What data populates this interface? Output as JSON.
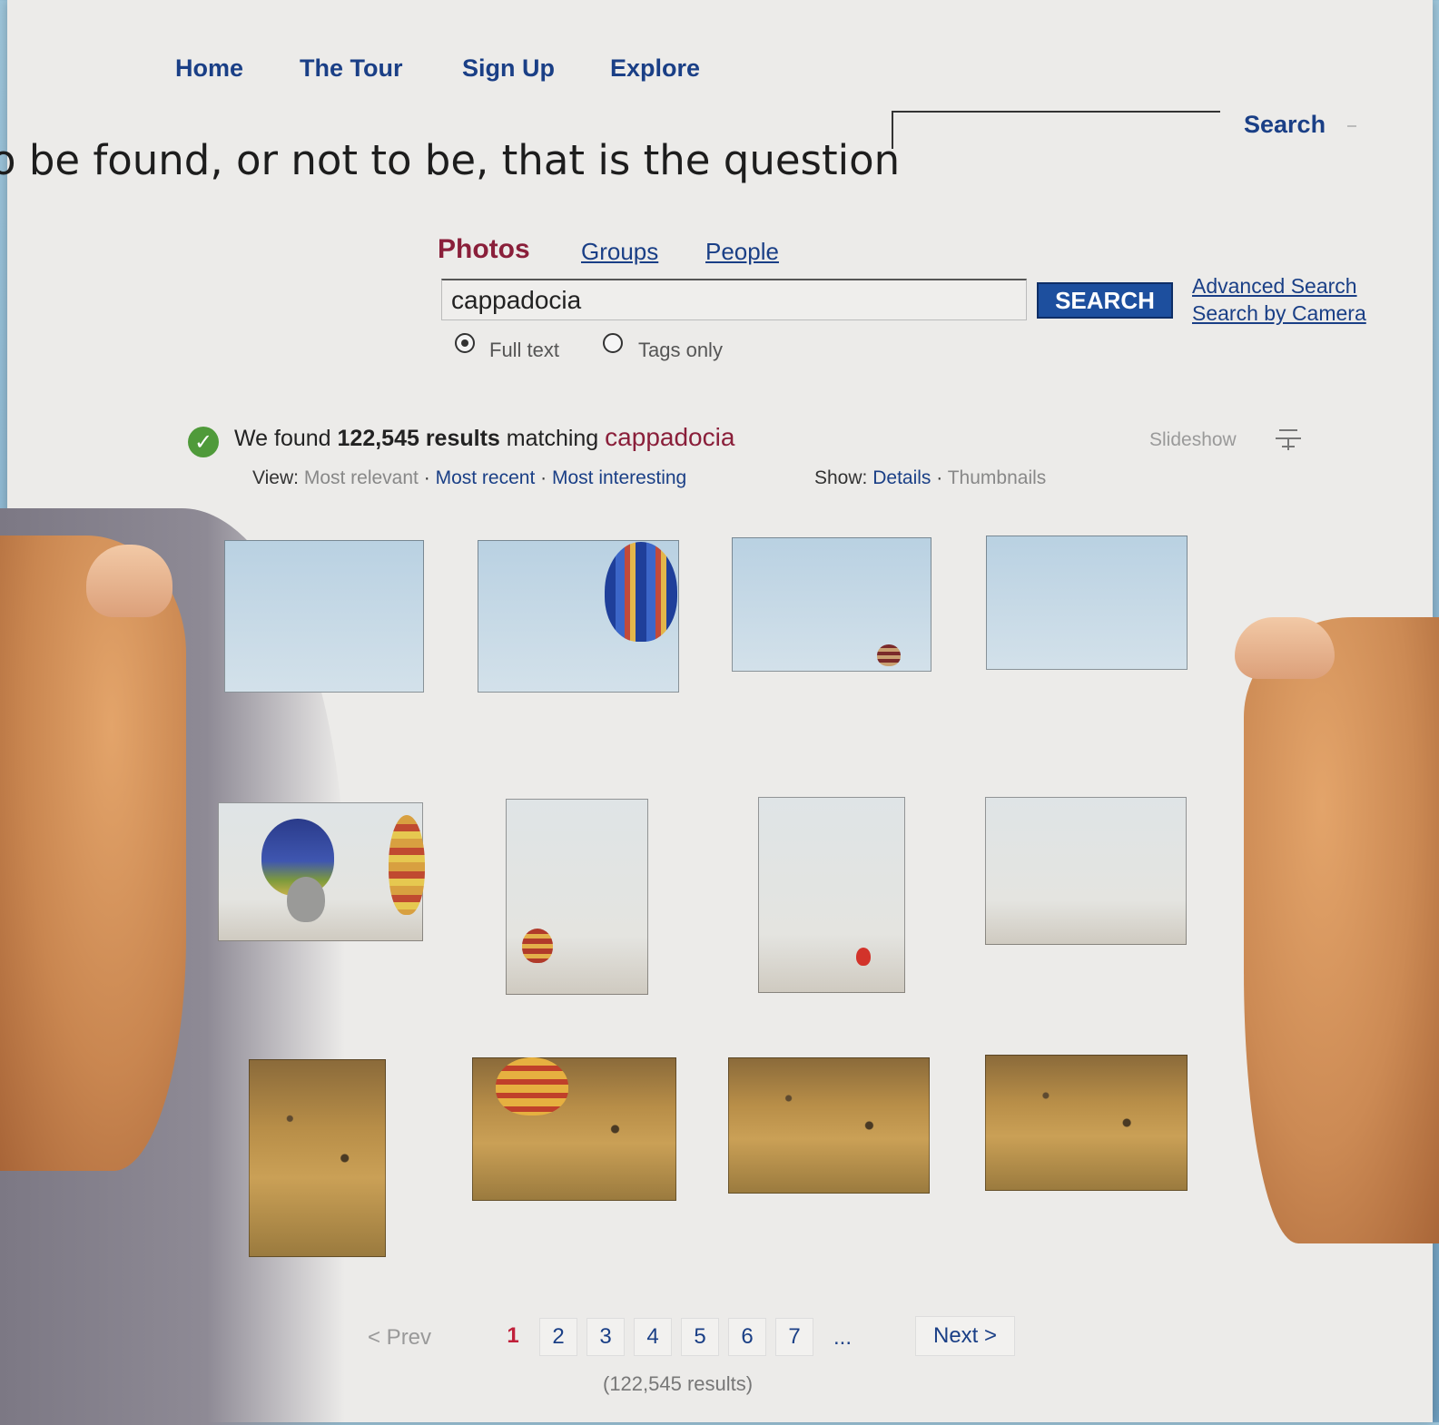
{
  "nav": {
    "home": "Home",
    "tour": "The Tour",
    "signup": "Sign Up",
    "explore": "Explore"
  },
  "top_search": {
    "label": "Search"
  },
  "tagline": "o be found, or not to be, that is the question",
  "tabs": {
    "photos": "Photos",
    "groups": "Groups",
    "people": "People"
  },
  "search": {
    "value": "cappadocia",
    "button": "SEARCH",
    "advanced": "Advanced Search",
    "camera": "Search by Camera"
  },
  "options": {
    "full_text": "Full text",
    "tags_only": "Tags only"
  },
  "results": {
    "prefix": "We found",
    "count": "122,545 results",
    "matching": "matching",
    "query": "cappadocia",
    "view_label": "View:",
    "view_relevant": "Most relevant",
    "view_recent": "Most recent",
    "view_interesting": "Most interesting",
    "show_label": "Show:",
    "show_details": "Details",
    "show_thumbnails": "Thumbnails",
    "slideshow": "Slideshow",
    "sep": "·"
  },
  "pager": {
    "prev": "< Prev",
    "pages": [
      "1",
      "2",
      "3",
      "4",
      "5",
      "6",
      "7"
    ],
    "ellipsis": "...",
    "next": "Next >",
    "total": "(122,545 results)"
  },
  "colors": {
    "link": "#1a3f86",
    "accent": "#8a1f3a",
    "button": "#1d4f9e",
    "check": "#4f9a3a"
  }
}
